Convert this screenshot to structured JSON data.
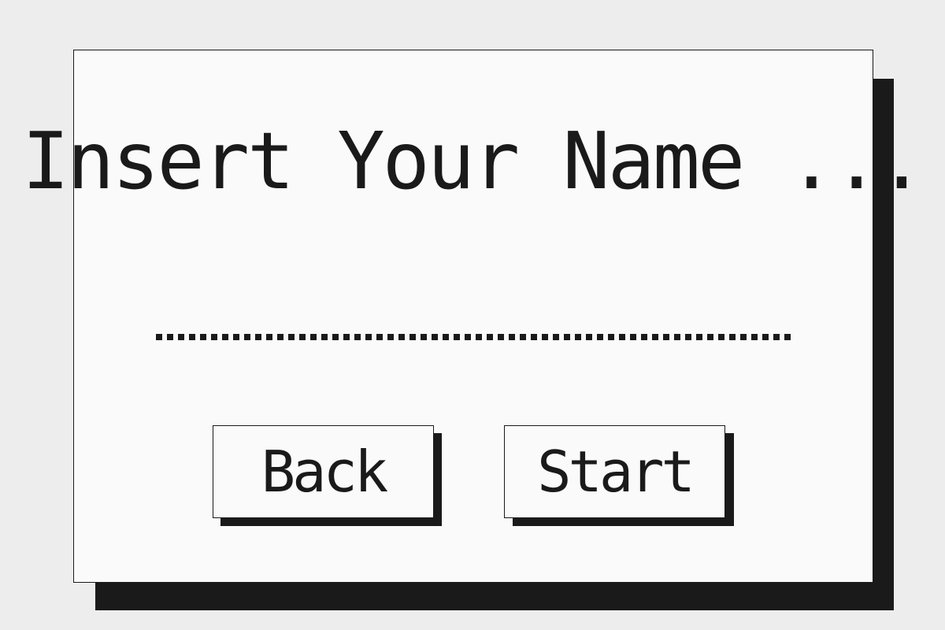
{
  "dialog": {
    "title": "Insert Your Name ...",
    "name_input": {
      "value": "",
      "placeholder": ""
    },
    "buttons": {
      "back_label": "Back",
      "start_label": "Start"
    }
  },
  "colors": {
    "background": "#ededed",
    "panel": "#fafafa",
    "ink": "#1a1a1a"
  }
}
